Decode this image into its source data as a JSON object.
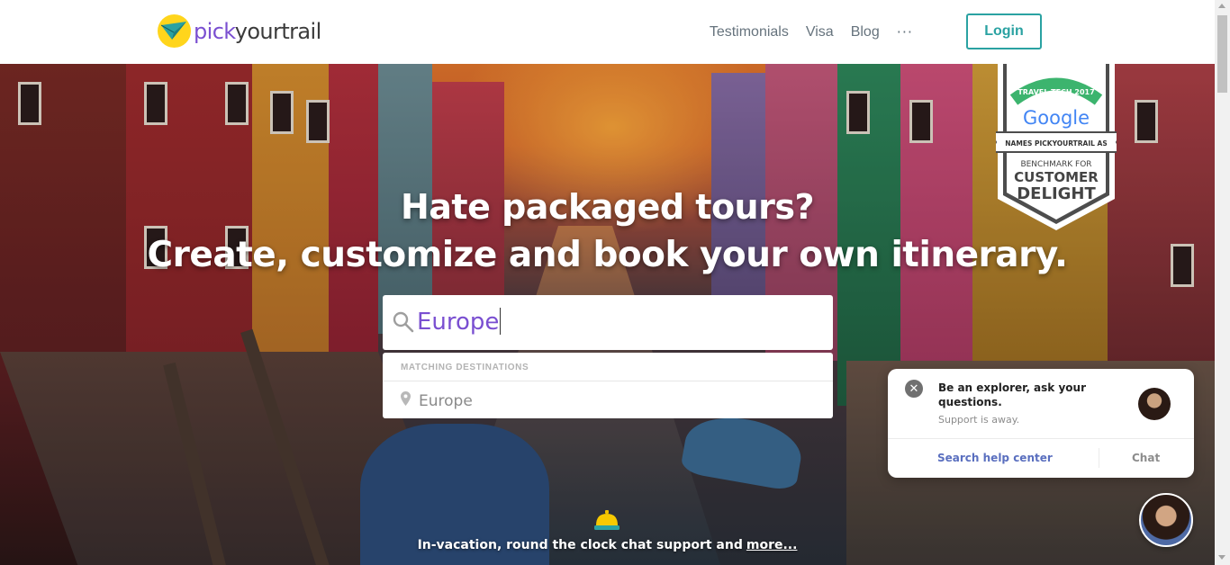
{
  "brand": {
    "name_part1": "pick",
    "name_part2": "yourtrail",
    "logo_icon": "paper-plane-icon"
  },
  "nav": {
    "items": [
      {
        "label": "Testimonials"
      },
      {
        "label": "Visa"
      },
      {
        "label": "Blog"
      }
    ],
    "more_label": "···",
    "login_label": "Login"
  },
  "hero": {
    "headline_1": "Hate packaged tours?",
    "headline_2": "Create, customize and book your own itinerary."
  },
  "badge": {
    "line1": "TRAVEL TECH 2017",
    "brand": "Google",
    "ribbon": "NAMES PICKYOURTRAIL AS",
    "line3": "BENCHMARK FOR",
    "line4": "CUSTOMER",
    "line5": "DELIGHT"
  },
  "search": {
    "value": "Europe",
    "dropdown_header": "MATCHING DESTINATIONS",
    "results": [
      {
        "label": "Europe",
        "icon": "location-pin-icon"
      }
    ]
  },
  "support": {
    "text": "In-vacation, round the clock chat support and",
    "more_link": "more...",
    "icon": "service-bell-icon"
  },
  "chat_widget": {
    "title": "Be an explorer, ask your questions.",
    "status": "Support is away.",
    "help_center_label": "Search help center",
    "chat_label": "Chat",
    "close_icon": "close-icon"
  },
  "colors": {
    "brand_purple": "#7a4fd1",
    "accent_teal": "#2aa2a2",
    "logo_yellow": "#ffd51c"
  }
}
